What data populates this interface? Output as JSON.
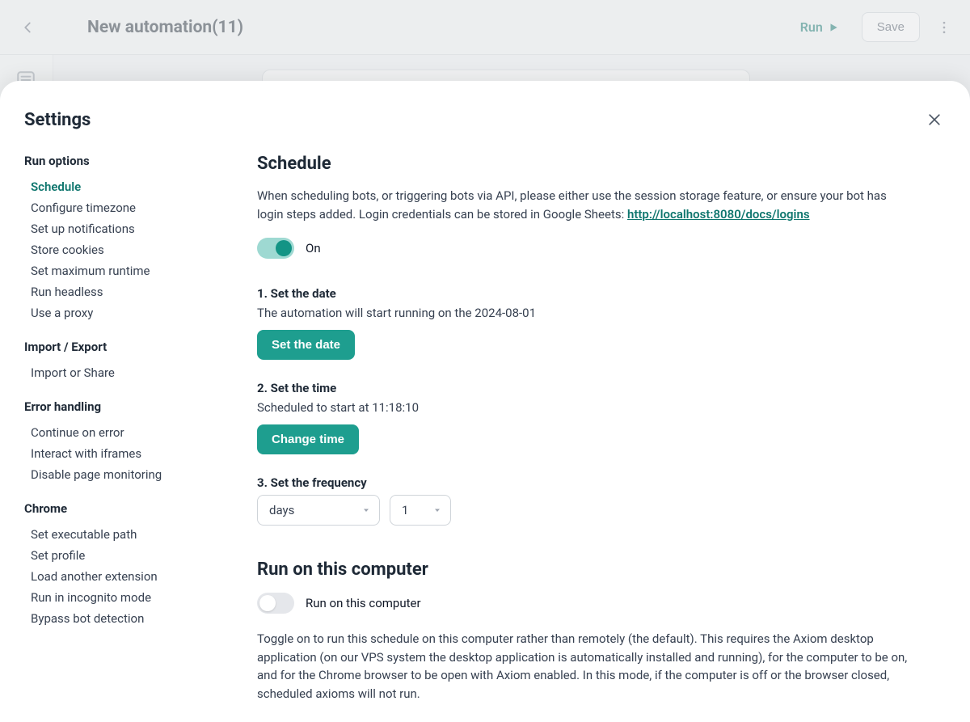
{
  "bg": {
    "title": "New automation(11)",
    "run_label": "Run",
    "save_label": "Save"
  },
  "modal": {
    "title": "Settings"
  },
  "nav": {
    "groups": [
      {
        "label": "Run options",
        "items": [
          "Schedule",
          "Configure timezone",
          "Set up notifications",
          "Store cookies",
          "Set maximum runtime",
          "Run headless",
          "Use a proxy"
        ],
        "active_index": 0
      },
      {
        "label": "Import / Export",
        "items": [
          "Import or Share"
        ]
      },
      {
        "label": "Error handling",
        "items": [
          "Continue on error",
          "Interact with iframes",
          "Disable page monitoring"
        ]
      },
      {
        "label": "Chrome",
        "items": [
          "Set executable path",
          "Set profile",
          "Load another extension",
          "Run in incognito mode",
          "Bypass bot detection"
        ]
      }
    ]
  },
  "schedule": {
    "title": "Schedule",
    "description_prefix": "When scheduling bots, or triggering bots via API, please either use the session storage feature, or ensure your bot has login steps added. Login credentials can be stored in Google Sheets: ",
    "description_link_text": "http://localhost:8080/docs/logins",
    "description_link_href": "http://localhost:8080/docs/logins",
    "toggle_on": true,
    "toggle_label": "On",
    "step1": {
      "title": "1. Set the date",
      "desc": "The automation will start running on the 2024-08-01",
      "btn": "Set the date"
    },
    "step2": {
      "title": "2. Set the time",
      "desc": "Scheduled to start at 11:18:10",
      "btn": "Change time"
    },
    "step3": {
      "title": "3. Set the frequency",
      "unit": "days",
      "count": "1"
    }
  },
  "runlocal": {
    "title": "Run on this computer",
    "toggle_on": false,
    "toggle_label": "Run on this computer",
    "desc": "Toggle on to run this schedule on this computer rather than remotely (the default). This requires the Axiom desktop application (on our VPS system the desktop application is automatically installed and running), for the computer to be on, and for the Chrome browser to be open with Axiom enabled. In this mode, if the computer is off or the browser closed, scheduled axioms will not run."
  }
}
